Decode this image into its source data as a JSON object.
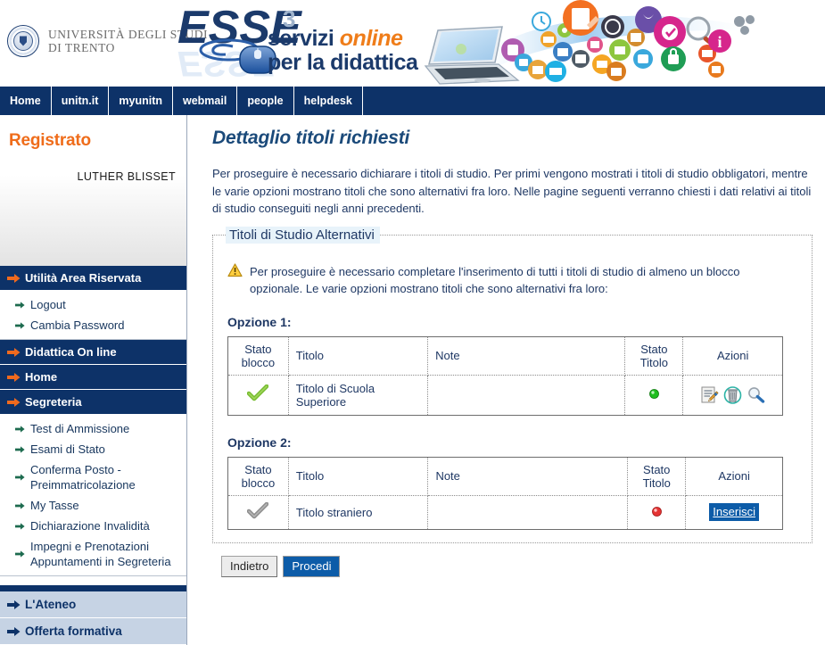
{
  "header": {
    "university_line1": "Università degli Studi",
    "university_line2": "di Trento",
    "brand_logo": "ESSE3",
    "brand_line1_plain": "servizi ",
    "brand_line1_accent": "online",
    "brand_line2": "per la didattica",
    "crest_icon": "university-crest-icon",
    "hero_icon": "laptop-and-app-icons-illustration"
  },
  "topnav": {
    "items": [
      {
        "label": "Home"
      },
      {
        "label": "unitn.it"
      },
      {
        "label": "myunitn"
      },
      {
        "label": "webmail"
      },
      {
        "label": "people"
      },
      {
        "label": "helpdesk"
      }
    ]
  },
  "sidebar": {
    "role": "Registrato",
    "user_name": "LUTHER BLISSET",
    "sections": [
      {
        "title": "Utilità Area Riservata",
        "items": [
          {
            "label": "Logout"
          },
          {
            "label": "Cambia Password"
          }
        ]
      },
      {
        "title": "Didattica On line",
        "items": []
      },
      {
        "title": "Home",
        "items": []
      },
      {
        "title": "Segreteria",
        "items": [
          {
            "label": "Test di Ammissione"
          },
          {
            "label": "Esami di Stato"
          },
          {
            "label": "Conferma Posto - Preimmatricolazione"
          },
          {
            "label": "My Tasse"
          },
          {
            "label": "Dichiarazione Invalidità"
          },
          {
            "label": "Impegni e Prenotazioni Appuntamenti in Segreteria"
          }
        ]
      }
    ],
    "bottom_sections": [
      {
        "title": "L'Ateneo"
      },
      {
        "title": "Offerta formativa"
      }
    ]
  },
  "main": {
    "page_title": "Dettaglio titoli richiesti",
    "intro": "Per proseguire è necessario dichiarare i titoli di studio. Per primi vengono mostrati i titoli di studio obbligatori, mentre le varie opzioni mostrano titoli che sono alternativi fra loro. Nelle pagine seguenti verranno chiesti i dati relativi ai titoli di studio conseguiti negli anni precedenti.",
    "fieldset_legend": "Titoli di Studio Alternativi",
    "warning_icon": "warning-triangle-icon",
    "warning_text": "Per proseguire è necessario completare l'inserimento di tutti i titoli di studio di almeno un blocco opzionale. Le varie opzioni mostrano titoli che sono alternativi fra loro:",
    "columns": [
      "Stato blocco",
      "Titolo",
      "Note",
      "Stato Titolo",
      "Azioni"
    ],
    "column_parts": {
      "stato_blocco_l1": "Stato",
      "stato_blocco_l2": "blocco",
      "titolo": "Titolo",
      "note": "Note",
      "stato_titolo_l1": "Stato",
      "stato_titolo_l2": "Titolo",
      "azioni": "Azioni"
    },
    "options": [
      {
        "label": "Opzione 1:",
        "rows": [
          {
            "block_status_icon": "green-check-icon",
            "block_status_color": "#76bb2f",
            "title": "Titolo di Scuola Superiore",
            "note": "",
            "title_status_icon": "green-led-icon",
            "title_status_color": "#1ec81e",
            "actions": [
              {
                "icon": "edit-document-icon",
                "label": ""
              },
              {
                "icon": "delete-trash-icon",
                "label": ""
              },
              {
                "icon": "view-magnifier-icon",
                "label": ""
              }
            ]
          }
        ]
      },
      {
        "label": "Opzione 2:",
        "rows": [
          {
            "block_status_icon": "grey-check-icon",
            "block_status_color": "#8c8c8c",
            "title": "Titolo straniero",
            "note": "",
            "title_status_icon": "red-led-icon",
            "title_status_color": "#e53434",
            "actions": [
              {
                "icon": "insert-link",
                "label": "Inserisci"
              }
            ]
          }
        ]
      }
    ],
    "buttons": {
      "back": "Indietro",
      "proceed": "Procedi"
    }
  }
}
